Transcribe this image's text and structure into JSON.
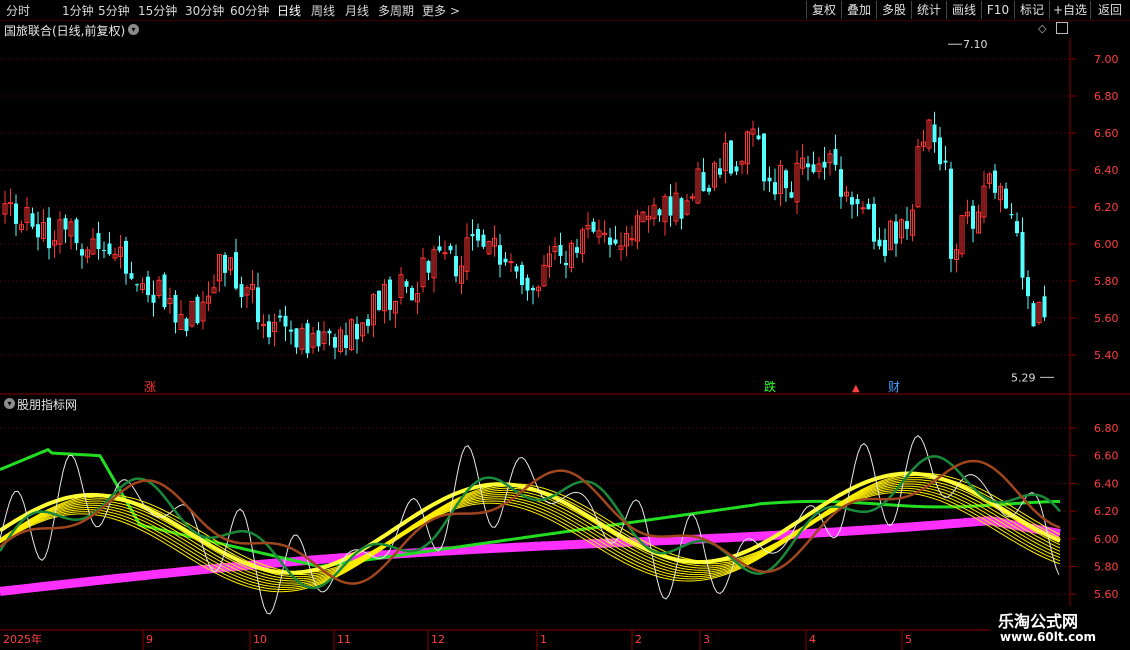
{
  "toolbar": {
    "periods": [
      "分时",
      "1分钟",
      "5分钟",
      "15分钟",
      "30分钟",
      "60分钟",
      "日线",
      "周线",
      "月线",
      "多周期",
      "更多 >"
    ],
    "active_period": "日线",
    "buttons": [
      "复权",
      "叠加",
      "多股",
      "统计",
      "画线",
      "F10",
      "标记",
      "+自选",
      "返回"
    ]
  },
  "main_chart": {
    "title": "国旅联合(日线,前复权)",
    "price_ticks": [
      "7.00",
      "6.80",
      "6.60",
      "6.40",
      "6.20",
      "6.00",
      "5.80",
      "5.60",
      "5.40"
    ],
    "high_label": "7.10",
    "low_label": "5.29",
    "markers": [
      {
        "text": "涨",
        "color": "#ff3030"
      },
      {
        "text": "跌",
        "color": "#30ff30"
      },
      {
        "text": "财",
        "color": "#40a0ff"
      }
    ]
  },
  "indicator": {
    "title": "股朋指标网",
    "ticks": [
      "6.80",
      "6.60",
      "6.40",
      "6.20",
      "6.00",
      "5.80",
      "5.60"
    ]
  },
  "date_axis": {
    "year_label": "2025年",
    "months": [
      "9",
      "10",
      "11",
      "12",
      "1",
      "2",
      "3",
      "4",
      "5"
    ]
  },
  "watermark": {
    "line1": "乐淘公式网",
    "line2": "www.60lt.com"
  },
  "colors": {
    "up": "#ff3232",
    "down": "#54ffff",
    "grid": "#6b0000",
    "axis": "#8b0000"
  }
}
